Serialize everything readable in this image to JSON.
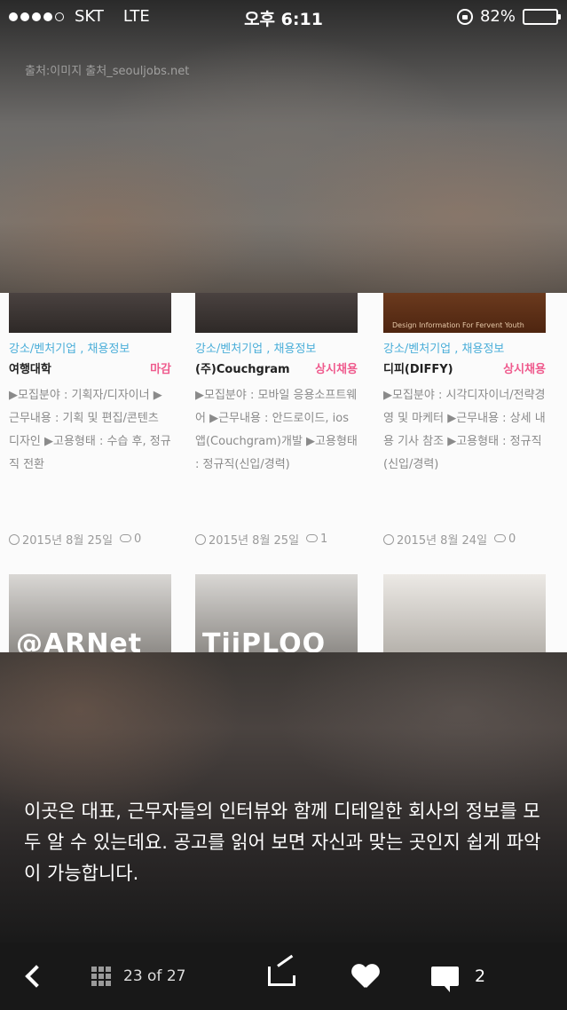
{
  "status_bar": {
    "carrier": "SKT",
    "network": "LTE",
    "time": "오후 6:11",
    "battery": "82%",
    "battery_level": 0.82,
    "signal_bars": 4
  },
  "source_credit": "출처:이미지 출처_seouljobs.net",
  "screenshot": {
    "thumb_top_texts": [
      "",
      "",
      "Design Information For Fervent Youth"
    ],
    "cards": [
      {
        "category": "강소/벤처기업 , 채용정보",
        "company": "여행대학",
        "tag": "마감",
        "details": "▶모집분야 : 기획자/디자이너 ▶근무내용 : 기획 및 편집/콘텐츠 디자인 ▶고용형태 : 수습 후, 정규직 전환",
        "date": "2015년 8월 25일",
        "comments": "0",
        "thumb_bottom_text": "@ARNet"
      },
      {
        "category": "강소/벤처기업 , 채용정보",
        "company": "(주)Couchgram",
        "tag": "상시채용",
        "details": "▶모집분야 : 모바일 응용소프트웨어 ▶근무내용 : 안드로이드, ios앱(Couchgram)개발 ▶고용형태 : 정규직(신입/경력)",
        "date": "2015년 8월 25일",
        "comments": "1",
        "thumb_bottom_text": "TiiPLOO"
      },
      {
        "category": "강소/벤처기업 , 채용정보",
        "company": "디피(DIFFY)",
        "tag": "상시채용",
        "details": "▶모집분야 : 시각디자이너/전략경영 및 마케터 ▶근무내용 : 상세 내용 기사 참조 ▶고용형태 : 정규직(신입/경력)",
        "date": "2015년 8월 24일",
        "comments": "0",
        "thumb_bottom_text": ""
      }
    ]
  },
  "caption": "이곳은 대표, 근무자들의 인터뷰와 함께 디테일한 회사의 정보를 모두 알 수 있는데요. 공고를 읽어 보면 자신과 맞는 곳인지 쉽게 파악이 가능합니다.",
  "toolbar": {
    "counter": "23 of 27",
    "comment_count": "2"
  },
  "icons": {
    "back": "chevron-left-icon",
    "grid": "grid-icon",
    "share": "share-icon",
    "like": "heart-icon",
    "comment": "comment-icon"
  }
}
